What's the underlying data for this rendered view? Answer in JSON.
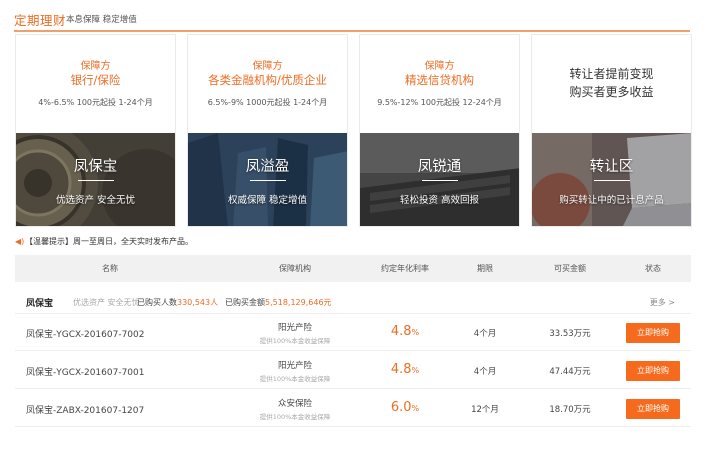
{
  "header": {
    "title": "定期理财",
    "subtitle": "本息保障 稳定增值"
  },
  "cards": [
    {
      "line1": "保障方",
      "line2": "银行/保险",
      "line3": "4%-6.5% 100元起投 1-24个月",
      "name": "凤保宝",
      "tag": "优选资产 安全无忧"
    },
    {
      "line1": "保障方",
      "line2": "各类金融机构/优质企业",
      "line3": "6.5%-9% 1000元起投 1-24个月",
      "name": "凤溢盈",
      "tag": "权威保障 稳定增值"
    },
    {
      "line1": "保障方",
      "line2": "精选信贷机构",
      "line3": "9.5%-12% 100元起投 12-24个月",
      "name": "凤锐通",
      "tag": "轻松投资 高效回报"
    },
    {
      "big1": "转让者提前变现",
      "big2": "购买者更多收益",
      "name": "转让区",
      "tag": "购买转让中的已计息产品"
    }
  ],
  "notice": "【温馨提示】周一至周日，全天实时发布产品。",
  "table": {
    "headers": [
      "名称",
      "保障机构",
      "约定年化利率",
      "期限",
      "可买金额",
      "状态"
    ]
  },
  "group": {
    "name": "凤保宝",
    "tag": "优选资产 安全无忧",
    "buyers_label": "已购买人数",
    "buyers_value": "330,543人",
    "amount_label": "已购买金额",
    "amount_value": "5,518,129,646元",
    "more": "更多 >"
  },
  "rows": [
    {
      "name": "凤保宝-YGCX-201607-7002",
      "inst": "阳光产险",
      "inst_note": "提供100%本金收益保障",
      "rate": "4.8",
      "pct": "%",
      "term": "4个月",
      "amount": "33.53万元",
      "button": "立即抢购"
    },
    {
      "name": "凤保宝-YGCX-201607-7001",
      "inst": "阳光产险",
      "inst_note": "提供100%本金收益保障",
      "rate": "4.8",
      "pct": "%",
      "term": "4个月",
      "amount": "47.44万元",
      "button": "立即抢购"
    },
    {
      "name": "凤保宝-ZABX-201607-1207",
      "inst": "众安保险",
      "inst_note": "提供100%本金收益保障",
      "rate": "6.0",
      "pct": "%",
      "term": "12个月",
      "amount": "18.70万元",
      "button": "立即抢购"
    }
  ],
  "colors": {
    "accent": "#ee6c23",
    "button": "#f56a1c"
  },
  "icons": {
    "notice": "speaker-icon"
  }
}
